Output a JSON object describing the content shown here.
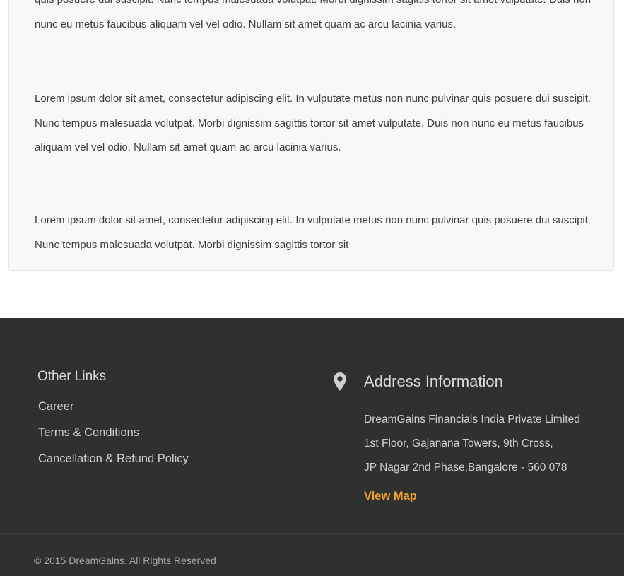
{
  "content": {
    "paragraphs": [
      "quis posuere dui suscipit. Nunc tempus malesuada volutpat. Morbi dignissim sagittis tortor sit amet vulputate. Duis non nunc eu metus faucibus aliquam vel vel odio. Nullam sit amet quam ac arcu lacinia varius.",
      "Lorem ipsum dolor sit amet, consectetur adipiscing elit. In vulputate metus non nunc pulvinar quis posuere dui suscipit. Nunc tempus malesuada volutpat. Morbi dignissim sagittis tortor sit amet vulputate. Duis non nunc eu metus faucibus aliquam vel vel odio. Nullam sit amet quam ac arcu lacinia varius.",
      "Lorem ipsum dolor sit amet, consectetur adipiscing elit. In vulputate metus non nunc pulvinar quis posuere dui suscipit. Nunc tempus malesuada volutpat. Morbi dignissim sagittis tortor sit"
    ]
  },
  "footer": {
    "other_links": {
      "heading": "Other Links",
      "items": [
        "Career",
        "Terms & Conditions",
        "Cancellation & Refund Policy"
      ]
    },
    "address": {
      "icon": "map-pin-icon",
      "heading": "Address Information",
      "lines": [
        "DreamGains Financials India Private Limited",
        "1st Floor, Gajanana Towers, 9th Cross,",
        "JP Nagar 2nd Phase,Bangalore - 560 078"
      ],
      "view_map_label": "View Map"
    },
    "copyright": "© 2015 DreamGains. All Rights Reserved"
  },
  "colors": {
    "footer_background": "#2f3030",
    "card_background": "#f7f8f9",
    "accent": "#f0a321"
  }
}
